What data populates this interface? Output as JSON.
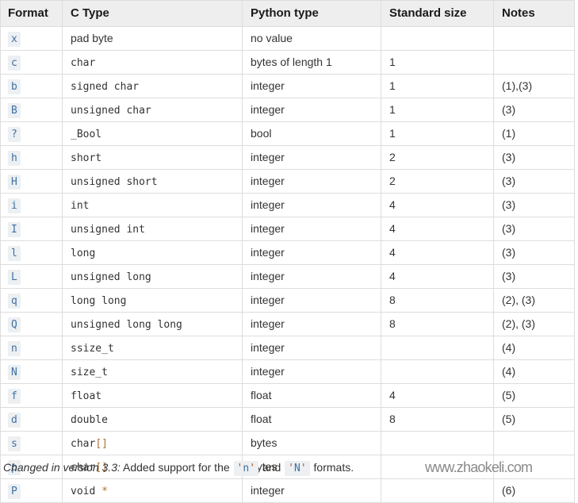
{
  "table": {
    "headers": [
      "Format",
      "C Type",
      "Python type",
      "Standard size",
      "Notes"
    ],
    "rows": [
      {
        "format": "x",
        "ctype": "pad byte",
        "ctype_style": "plain",
        "pytype": "no value",
        "size": "",
        "notes": ""
      },
      {
        "format": "c",
        "ctype": "char",
        "ctype_style": "code",
        "pytype": "bytes of length 1",
        "size": "1",
        "notes": ""
      },
      {
        "format": "b",
        "ctype": "signed char",
        "ctype_style": "code",
        "pytype": "integer",
        "size": "1",
        "notes": "(1),(3)"
      },
      {
        "format": "B",
        "ctype": "unsigned char",
        "ctype_style": "code",
        "pytype": "integer",
        "size": "1",
        "notes": "(3)"
      },
      {
        "format": "?",
        "ctype": "_Bool",
        "ctype_style": "code",
        "pytype": "bool",
        "size": "1",
        "notes": "(1)"
      },
      {
        "format": "h",
        "ctype": "short",
        "ctype_style": "code",
        "pytype": "integer",
        "size": "2",
        "notes": "(3)"
      },
      {
        "format": "H",
        "ctype": "unsigned short",
        "ctype_style": "code",
        "pytype": "integer",
        "size": "2",
        "notes": "(3)"
      },
      {
        "format": "i",
        "ctype": "int",
        "ctype_style": "code",
        "pytype": "integer",
        "size": "4",
        "notes": "(3)"
      },
      {
        "format": "I",
        "ctype": "unsigned int",
        "ctype_style": "code",
        "pytype": "integer",
        "size": "4",
        "notes": "(3)"
      },
      {
        "format": "l",
        "ctype": "long",
        "ctype_style": "code",
        "pytype": "integer",
        "size": "4",
        "notes": "(3)"
      },
      {
        "format": "L",
        "ctype": "unsigned long",
        "ctype_style": "code",
        "pytype": "integer",
        "size": "4",
        "notes": "(3)"
      },
      {
        "format": "q",
        "ctype": "long long",
        "ctype_style": "code",
        "pytype": "integer",
        "size": "8",
        "notes": "(2), (3)"
      },
      {
        "format": "Q",
        "ctype": "unsigned long long",
        "ctype_style": "code",
        "pytype": "integer",
        "size": "8",
        "notes": "(2), (3)"
      },
      {
        "format": "n",
        "ctype": "ssize_t",
        "ctype_style": "code",
        "pytype": "integer",
        "size": "",
        "notes": "(4)"
      },
      {
        "format": "N",
        "ctype": "size_t",
        "ctype_style": "code",
        "pytype": "integer",
        "size": "",
        "notes": "(4)"
      },
      {
        "format": "f",
        "ctype": "float",
        "ctype_style": "code",
        "pytype": "float",
        "size": "4",
        "notes": "(5)"
      },
      {
        "format": "d",
        "ctype": "double",
        "ctype_style": "code",
        "pytype": "float",
        "size": "8",
        "notes": "(5)"
      },
      {
        "format": "s",
        "ctype": "char[]",
        "ctype_style": "code",
        "pytype": "bytes",
        "size": "",
        "notes": ""
      },
      {
        "format": "p",
        "ctype": "char[]",
        "ctype_style": "code",
        "pytype": "bytes",
        "size": "",
        "notes": ""
      },
      {
        "format": "P",
        "ctype": "void *",
        "ctype_style": "code",
        "pytype": "integer",
        "size": "",
        "notes": "(6)"
      }
    ]
  },
  "version_note": {
    "label": "Changed in version 3.3:",
    "text_before": " Added support for the ",
    "code_a": "'n'",
    "text_middle": " and ",
    "code_b": "'N'",
    "text_after": " formats."
  },
  "watermark": {
    "text": "www.zhaokeli.com"
  },
  "colors": {
    "header_bg": "#eeeeee",
    "border": "#dddddd",
    "code_bg": "#ecf0f3",
    "code_fg": "#4070a0",
    "text": "#333333",
    "watermark": "#8a8a8a"
  }
}
